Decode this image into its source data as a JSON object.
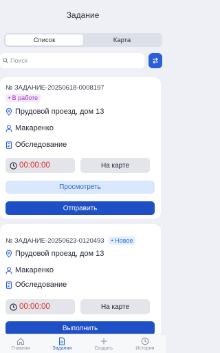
{
  "header": {
    "title": "Задание"
  },
  "segmented": {
    "tabs": [
      "Список",
      "Карта"
    ],
    "active": 0
  },
  "search": {
    "placeholder": "Поиск"
  },
  "cards": [
    {
      "order": "№ ЗАДАНИЕ-20250618-0008197",
      "status": "• В работе",
      "address": "Прудовой проезд, дом 13",
      "person": "Макаренко",
      "type": "Обследование",
      "timer": "00:00:00",
      "map_label": "На карте",
      "view_label": "Просмотреть",
      "action_label": "Отправить"
    },
    {
      "order": "№ ЗАДАНИЕ-20250623-0120493",
      "status": "• Новое",
      "address": "Прудовой проезд, дом 13",
      "person": "Макаренко",
      "type": "Обследование",
      "timer": "00:00:00",
      "map_label": "На карте",
      "action_label": "Выполнить"
    }
  ],
  "tabbar": {
    "items": [
      {
        "label": "Главная",
        "icon": "home-icon"
      },
      {
        "label": "Задания",
        "icon": "document-icon"
      },
      {
        "label": "Создать",
        "icon": "plus-icon"
      },
      {
        "label": "История",
        "icon": "history-icon"
      }
    ],
    "active": 1
  },
  "colors": {
    "accent": "#1e4fc7",
    "timer": "#e02b2b",
    "status_work": "#9b33c9",
    "status_new": "#2b6fd9"
  }
}
